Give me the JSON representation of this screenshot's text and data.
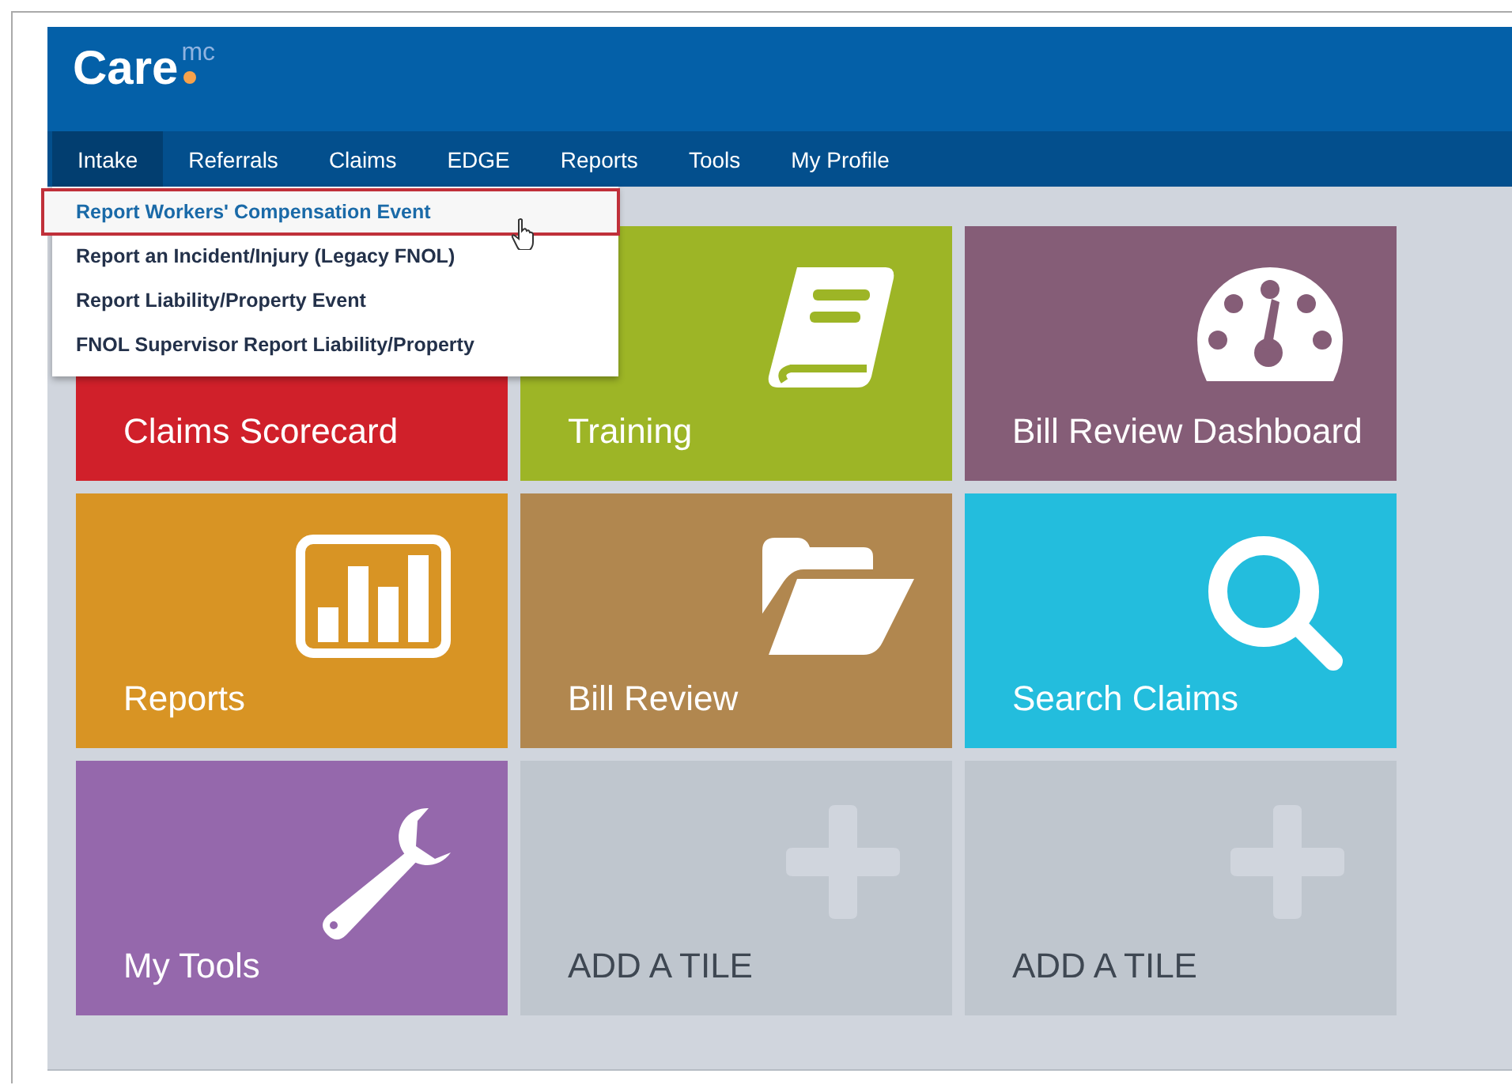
{
  "logo": {
    "text": "Care",
    "superscript": "mc"
  },
  "nav": [
    {
      "label": "Intake",
      "selected": true
    },
    {
      "label": "Referrals",
      "selected": false
    },
    {
      "label": "Claims",
      "selected": false
    },
    {
      "label": "EDGE",
      "selected": false
    },
    {
      "label": "Reports",
      "selected": false
    },
    {
      "label": "Tools",
      "selected": false
    },
    {
      "label": "My Profile",
      "selected": false
    }
  ],
  "dropdown": [
    {
      "label": "Report Workers' Compensation Event",
      "selected": true
    },
    {
      "label": "Report an Incident/Injury (Legacy FNOL)",
      "selected": false
    },
    {
      "label": "Report Liability/Property Event",
      "selected": false
    },
    {
      "label": "FNOL Supervisor Report Liability/Property",
      "selected": false
    }
  ],
  "tiles": [
    {
      "label": "Claims Scorecard",
      "kind": "plain",
      "color": "#d0202a"
    },
    {
      "label": "Training",
      "kind": "book",
      "color": "#9db526"
    },
    {
      "label": "Bill Review Dashboard",
      "kind": "gauge",
      "color": "#855d77"
    },
    {
      "label": "Reports",
      "kind": "chart",
      "color": "#d89424"
    },
    {
      "label": "Bill Review",
      "kind": "folder",
      "color": "#b1874f"
    },
    {
      "label": "Search Claims",
      "kind": "search",
      "color": "#23bddd"
    },
    {
      "label": "My Tools",
      "kind": "wrench",
      "color": "#9568ac"
    },
    {
      "label": "ADD A TILE",
      "kind": "add",
      "color": "#bfc6ce"
    },
    {
      "label": "ADD A TILE",
      "kind": "add",
      "color": "#bfc6ce"
    }
  ]
}
